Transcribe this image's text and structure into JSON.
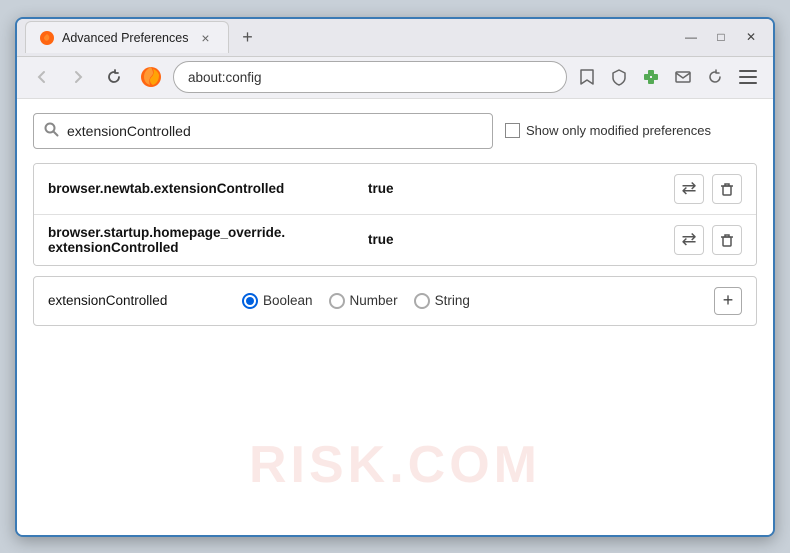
{
  "window": {
    "title": "Advanced Preferences",
    "tab_close": "×",
    "new_tab": "+",
    "win_minimize": "—",
    "win_maximize": "□",
    "win_close": "✕"
  },
  "nav": {
    "back_tooltip": "Back",
    "forward_tooltip": "Forward",
    "reload_tooltip": "Reload",
    "browser_name": "Firefox",
    "address": "about:config",
    "bookmark_tooltip": "Bookmark",
    "shield_tooltip": "Shield",
    "extension_tooltip": "Extension",
    "mail_tooltip": "Mail",
    "sync_tooltip": "Sync",
    "menu_tooltip": "Menu"
  },
  "search": {
    "placeholder": "extensionControlled",
    "value": "extensionControlled",
    "show_modified_label": "Show only modified preferences"
  },
  "preferences": [
    {
      "name": "browser.newtab.extensionControlled",
      "value": "true"
    },
    {
      "name_line1": "browser.startup.homepage_override.",
      "name_line2": "extensionControlled",
      "value": "true"
    }
  ],
  "add_pref": {
    "name": "extensionControlled",
    "radio_options": [
      {
        "id": "boolean",
        "label": "Boolean",
        "selected": true
      },
      {
        "id": "number",
        "label": "Number",
        "selected": false
      },
      {
        "id": "string",
        "label": "String",
        "selected": false
      }
    ],
    "add_label": "+"
  },
  "watermark": "RISK.COM"
}
